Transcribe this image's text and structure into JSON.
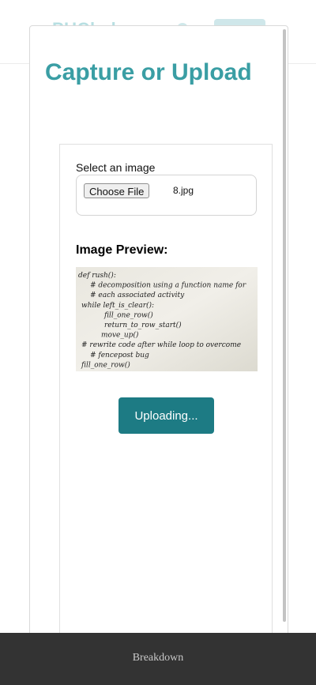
{
  "background_header": {
    "brand_text": "PUCbaker"
  },
  "modal": {
    "title": "Capture or Upload",
    "select_label": "Select an image",
    "file_input": {
      "button_label": "Choose File",
      "file_name": "8.jpg"
    },
    "preview_heading": "Image Preview:",
    "preview_image": {
      "handwritten_lines": [
        "def rush():",
        "# decomposition using a function name for",
        "# each associated activity",
        "while left_is_clear():",
        "fill_one_row()",
        "return_to_row_start()",
        "move_up()",
        "# rewrite code after while loop to overcome",
        "# fencepost bug",
        "fill_one_row()"
      ]
    },
    "upload_button_label": "Uploading..."
  },
  "footer": {
    "text": "Breakdown"
  },
  "colors": {
    "title": "#3a9ea4",
    "button": "#1d7b84",
    "footer_bg": "#333333"
  }
}
